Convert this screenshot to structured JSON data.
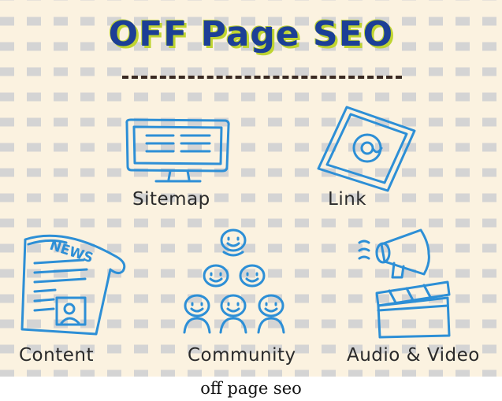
{
  "title": "OFF Page SEO",
  "labels": {
    "sitemap": "Sitemap",
    "link": "Link",
    "content": "Content",
    "community": "Community",
    "audio_video": "Audio & Video",
    "news": "NEWS",
    "at_sign": "@"
  },
  "caption": "off page seo",
  "colors": {
    "background": "#fbf2e0",
    "line": "#d4d4d4",
    "title_text": "#1c3f96",
    "title_shadow": "#bfd431",
    "icon_stroke": "#2d8fd6",
    "label_text": "#2a2a2a"
  },
  "icons": [
    "monitor-icon",
    "tablet-icon",
    "newspaper-icon",
    "people-pyramid-icon",
    "megaphone-icon",
    "clapperboard-icon"
  ]
}
